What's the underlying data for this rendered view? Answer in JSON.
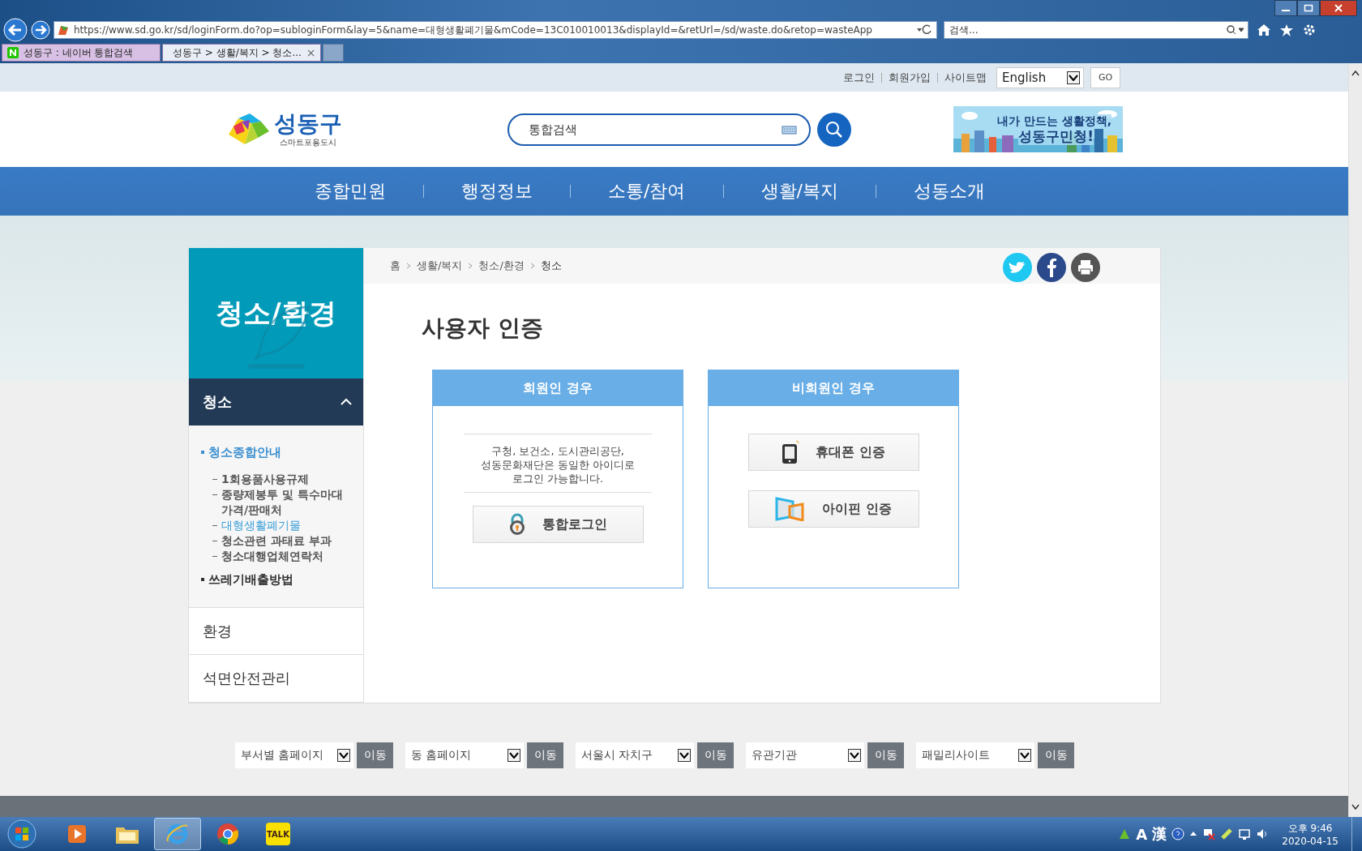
{
  "browser": {
    "url": "https://www.sd.go.kr/sd/loginForm.do?op=subloginForm&lay=5&name=대형생활폐기물&mCode=13C010010013&displayId=&retUrl=/sd/waste.do&retop=wasteApp",
    "search_placeholder": "검색...",
    "tabs": [
      {
        "label": "성동구 : 네이버 통합검색",
        "kind": "naver",
        "selected": false
      },
      {
        "label": "성동구 > 생활/복지 > 청소...",
        "kind": "site",
        "selected": true,
        "close": "×"
      }
    ]
  },
  "util_links": [
    "로그인",
    "회원가입",
    "사이트맵"
  ],
  "language": {
    "value": "English",
    "button": "GO"
  },
  "logo": {
    "name": "성동구",
    "tagline": "스마트포용도시"
  },
  "search": {
    "placeholder": "통합검색"
  },
  "banner": {
    "lines": [
      "내가 만드는 생활정책,",
      "성동구민청!"
    ]
  },
  "nav": [
    "종합민원",
    "행정정보",
    "소통/참여",
    "생활/복지",
    "성동소개"
  ],
  "sidebar": {
    "title": "청소/환경",
    "sections": [
      {
        "label": "청소",
        "expanded": true,
        "items": [
          {
            "label": "청소종합안내",
            "selected": true,
            "children": [
              {
                "label": "1회용품사용규제",
                "selected": false
              },
              {
                "label": "종량제봉투 및 특수마대 가격/판매처",
                "selected": false
              },
              {
                "label": "대형생활폐기물",
                "selected": true
              },
              {
                "label": "청소관련 과태료 부과",
                "selected": false
              },
              {
                "label": "청소대행업체연락처",
                "selected": false
              }
            ]
          },
          {
            "label": "쓰레기배출방법",
            "selected": false
          }
        ]
      },
      {
        "label": "환경",
        "expanded": false
      },
      {
        "label": "석면안전관리",
        "expanded": false
      }
    ]
  },
  "breadcrumb": [
    "홈",
    "생활/복지",
    "청소/환경",
    "청소"
  ],
  "page_title": "사용자 인증",
  "auth_boxes": [
    {
      "title": "회원인 경우",
      "note": "구청, 보건소, 도시관리공단,\n성동문화재단은 동일한 아이디로\n로그인 가능합니다.",
      "buttons": [
        {
          "label": "통합로그인",
          "kind": "lock"
        }
      ]
    },
    {
      "title": "비회원인 경우",
      "buttons": [
        {
          "label": "휴대폰 인증",
          "kind": "phone"
        },
        {
          "label": "아이핀 인증",
          "kind": "ipin"
        }
      ]
    }
  ],
  "footer_links": [
    {
      "value": "부서별 홈페이지",
      "button": "이동"
    },
    {
      "value": "동 홈페이지",
      "button": "이동"
    },
    {
      "value": "서울시 자치구",
      "button": "이동"
    },
    {
      "value": "유관기관",
      "button": "이동"
    },
    {
      "value": "패밀리사이트",
      "button": "이동"
    }
  ],
  "taskbar": {
    "apps": [
      {
        "kind": "media",
        "selected": false
      },
      {
        "kind": "folder",
        "selected": false
      },
      {
        "kind": "ie",
        "selected": true
      },
      {
        "kind": "chrome",
        "selected": false
      },
      {
        "kind": "kakao",
        "label": "TALK",
        "selected": false
      }
    ],
    "ime": [
      "A",
      "漢"
    ],
    "time": "오후 9:46",
    "date": "2020-04-15"
  }
}
